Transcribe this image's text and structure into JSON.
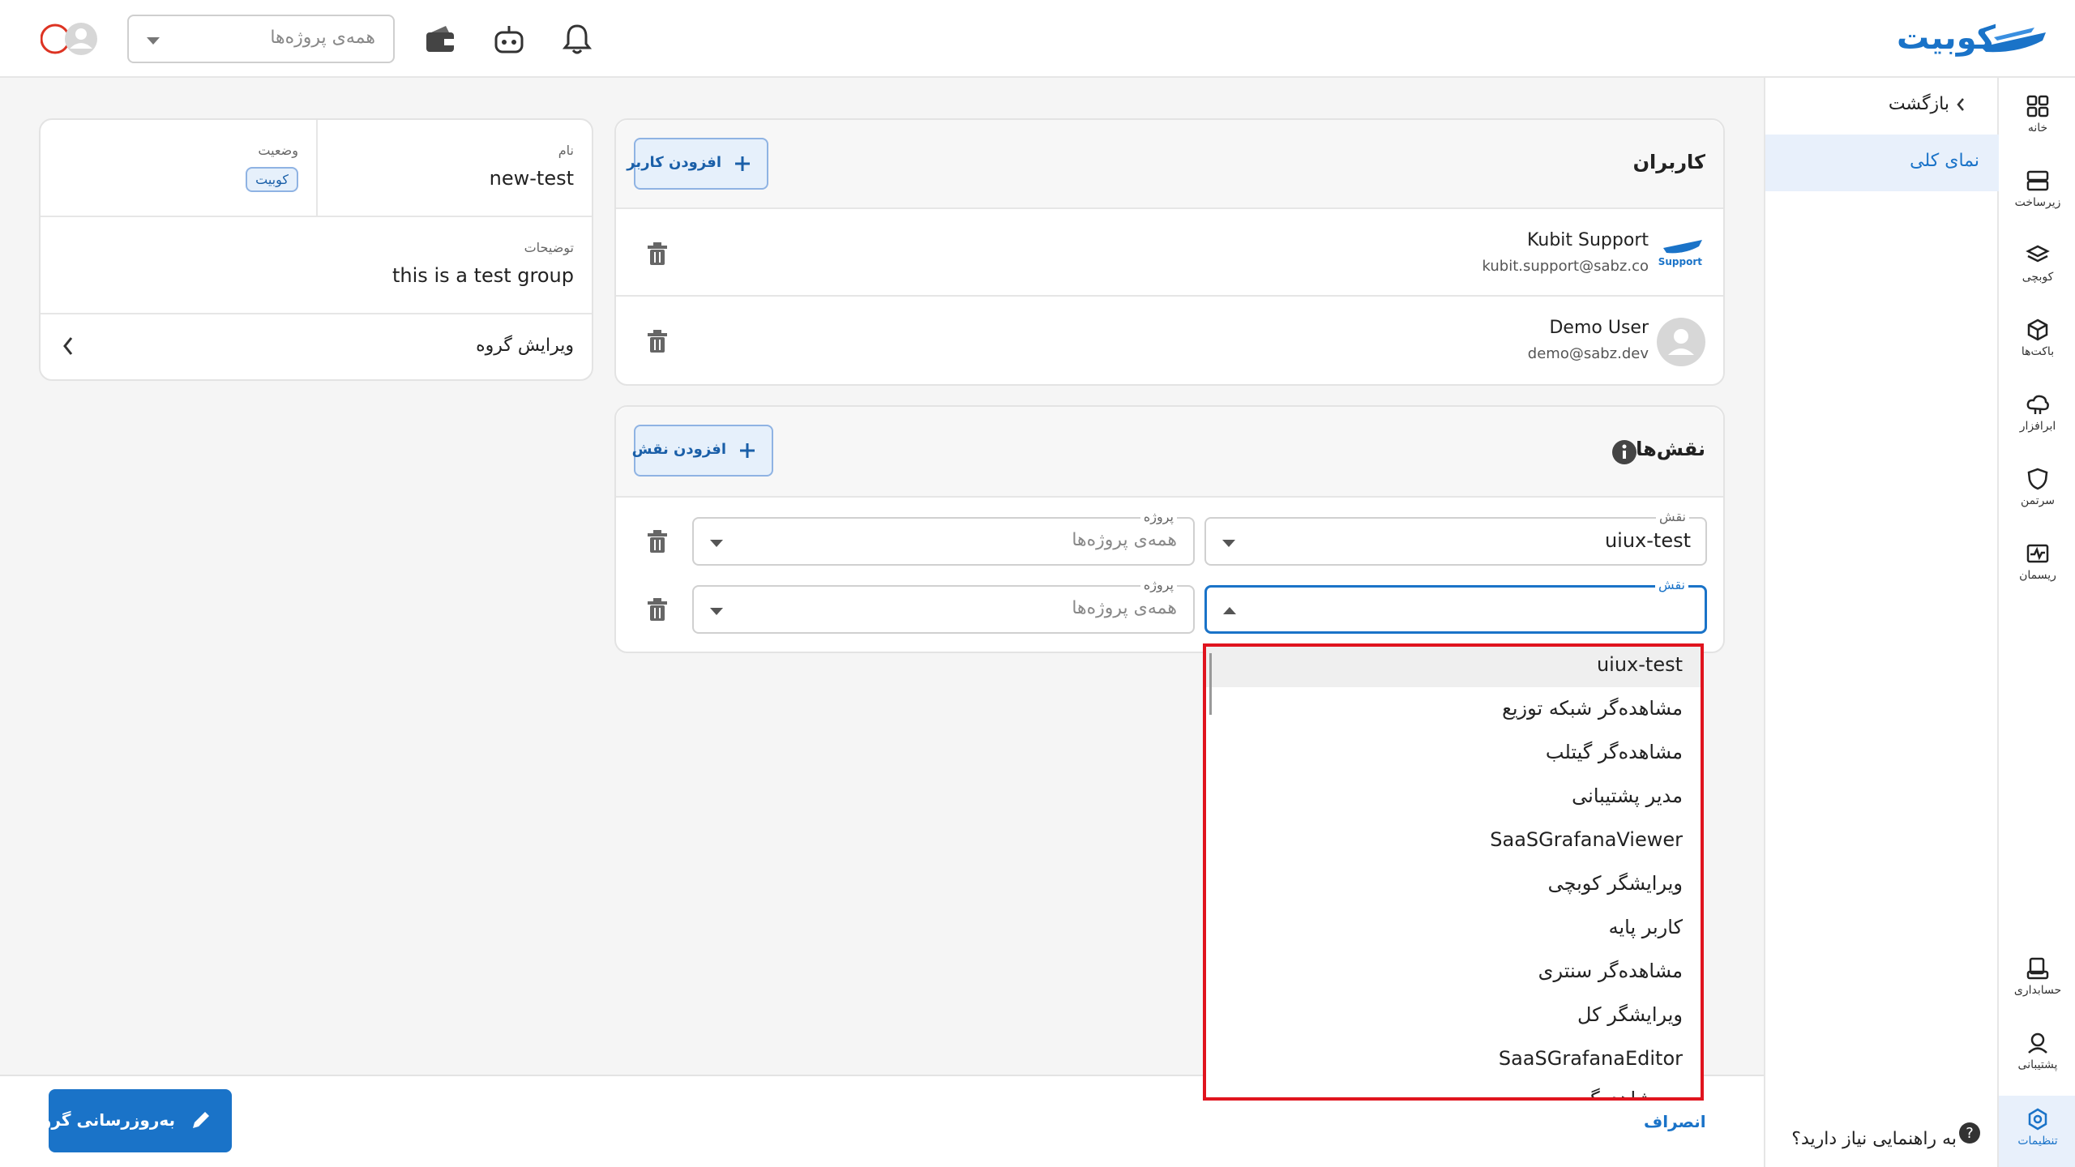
{
  "header": {
    "logo_text": "کوبیت",
    "project_select_placeholder": "همه‌ی پروژه‌ها",
    "icons": [
      "bell-icon",
      "robot-icon",
      "wallet-icon",
      "avatar-icon"
    ]
  },
  "rail": {
    "items": [
      {
        "label": "خانه",
        "icon": "grid-icon"
      },
      {
        "label": "زیرساخت",
        "icon": "server-icon"
      },
      {
        "label": "کوبچی",
        "icon": "layers-icon"
      },
      {
        "label": "باکت‌ها",
        "icon": "cube-icon"
      },
      {
        "label": "ابرافزار",
        "icon": "cloud-icon"
      },
      {
        "label": "سرتمن",
        "icon": "shield-icon"
      },
      {
        "label": "ریسمان",
        "icon": "pulse-icon"
      }
    ],
    "bottom_items": [
      {
        "label": "حسابداری",
        "icon": "accounting-icon"
      },
      {
        "label": "پشتیبانی",
        "icon": "support-icon"
      },
      {
        "label": "تنظیمات",
        "icon": "settings-icon"
      }
    ]
  },
  "subnav": {
    "back_label": "بازگشت",
    "active_label": "نمای کلی",
    "help_label": "به راهنمایی نیاز دارید؟"
  },
  "group_info": {
    "name_label": "نام",
    "name_value": "new-test",
    "status_label": "وضعیت",
    "status_value": "کوبیت",
    "desc_label": "توضیحات",
    "desc_value": "this is a test group",
    "edit_label": "ویرایش گروه"
  },
  "users": {
    "title": "کاربران",
    "add_label": "افزودن کاربر",
    "list": [
      {
        "name": "Kubit Support",
        "email": "kubit.support@sabz.co",
        "avatar_text": "Support"
      },
      {
        "name": "Demo User",
        "email": "demo@sabz.dev",
        "avatar_text": ""
      }
    ]
  },
  "roles": {
    "title": "نقش‌ها",
    "add_label": "افزودن نقش",
    "role_legend": "نقش",
    "project_legend": "پروژه",
    "rows": [
      {
        "role": "uiux-test",
        "project_placeholder": "همه‌ی پروژه‌ها"
      },
      {
        "role": "",
        "project_placeholder": "همه‌ی پروژه‌ها"
      }
    ]
  },
  "dropdown": {
    "options": [
      "uiux-test",
      "مشاهده‌گر شبکه توزیع",
      "مشاهده‌گر گیتلب",
      "مدیر پشتیبانی",
      "SaaSGrafanaViewer",
      "ویرایشگر کوبچی",
      "کاربر پایه",
      "مشاهده‌گر سنتری",
      "ویرایشگر کل",
      "SaaSGrafanaEditor",
      "مشاهده‌گر..."
    ]
  },
  "footer": {
    "update_label": "به‌روزرسانی گروه",
    "cancel_label": "انصراف"
  },
  "colors": {
    "accent": "#1a73c8",
    "highlight_border": "#e0141e"
  }
}
